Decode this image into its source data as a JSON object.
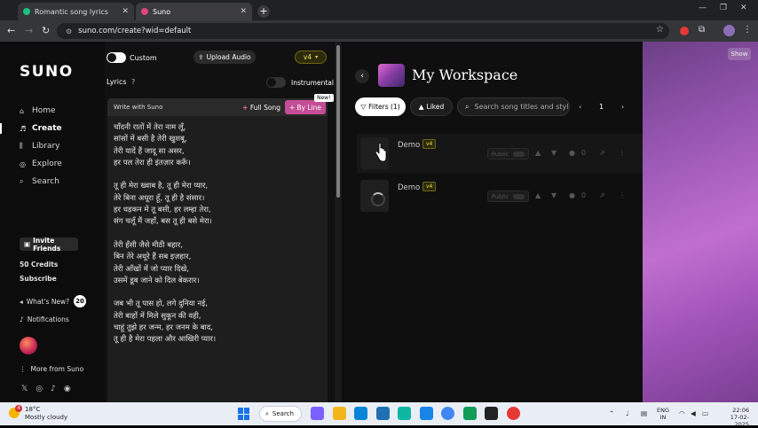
{
  "browser": {
    "tabs": [
      {
        "title": "Romantic song lyrics",
        "favicon_color": "#19c37d"
      },
      {
        "title": "Suno",
        "favicon_color": "#e0457b"
      }
    ],
    "new_tab": "+",
    "url": "suno.com/create?wid=default",
    "controls": {
      "minimize": "—",
      "maximize": "❐",
      "close": "✕"
    },
    "nav": {
      "back": "←",
      "forward": "→",
      "reload": "↻",
      "info": "⚙",
      "star": "☆",
      "extensions": "⧉"
    }
  },
  "sidebar": {
    "logo": "SUNO",
    "nav": [
      {
        "label": "Home",
        "icon": "home-icon",
        "glyph": "⌂"
      },
      {
        "label": "Create",
        "icon": "create-icon",
        "glyph": "♬"
      },
      {
        "label": "Library",
        "icon": "library-icon",
        "glyph": "⫼"
      },
      {
        "label": "Explore",
        "icon": "explore-icon",
        "glyph": "◎"
      },
      {
        "label": "Search",
        "icon": "search-icon",
        "glyph": "⌕"
      }
    ],
    "active": "Create",
    "invite": "Invite Friends",
    "credits": "50 Credits",
    "subscribe": "Subscribe",
    "whats_new": "What's New?",
    "whats_new_count": "20",
    "notifications": "Notifications",
    "more": "More from Suno",
    "socials": [
      "𝕏",
      "◎",
      "♪",
      "◉"
    ]
  },
  "create": {
    "custom_label": "Custom",
    "upload_label": "Upload Audio",
    "version": "v4",
    "lyrics_label": "Lyrics",
    "instrumental_label": "Instrumental",
    "write_with": "Write with Suno",
    "full_song": "Full Song",
    "by_line": "By Line",
    "new_badge": "New!",
    "lyrics_text": "चाँदनी रातों में तेरा नाम लूँ,\nसांसों में बसी है तेरी खुशबू,\nतेरी यादें हैं जादू सा असर,\nहर पल तेरा ही इंतज़ार करूँ।\n\nतू ही मेरा ख्वाब है, तू ही मेरा प्यार,\nतेरे बिना अधूरा हूँ, तू ही है संसार।\nहर धड़कन में तू बसी, हर लम्हा तेरा,\nसंग चलूँ मैं जहाँ, बस तू ही बसे मेरा।\n\nतेरी हँसी जैसे मीठी बहार,\nबिन तेरे अधूरे हैं सब इज़हार,\nतेरी आँखों में जो प्यार दिखे,\nउसमें डूब जाने को दिल बेकरार।\n\nजब भी तू पास हो, लगे दुनिया नई,\nतेरी बाहों में मिले सुकून की वही,\nचाहूं तुझे हर जन्म, हर जनम के बाद,\nतू ही है मेरा पहला और आखिरी प्यार।"
  },
  "workspace": {
    "title": "My Workspace",
    "filters": "Filters (1)",
    "liked": "Liked",
    "search_placeholder": "Search song titles and styles",
    "page": "1",
    "prev": "‹",
    "next": "›",
    "back": "‹",
    "songs": [
      {
        "title": "Demo",
        "version": "v4",
        "public": "Public",
        "likes": "0",
        "state": "ready"
      },
      {
        "title": "Demo",
        "version": "v4",
        "public": "Public",
        "likes": "0",
        "state": "loading"
      }
    ],
    "show_label": "Show"
  },
  "taskbar": {
    "weather_temp": "18°C",
    "weather_desc": "Mostly cloudy",
    "weather_badge": "4",
    "search": "Search",
    "lang_line1": "ENG",
    "lang_line2": "IN",
    "time": "22:06",
    "date": "17-02-2025",
    "app_colors": [
      "#7b61ff",
      "#f2b61c",
      "#0a84d6",
      "#1f6fb2",
      "#0db7a3",
      "#1684e8",
      "#4285f4",
      "#0f9d58",
      "#222222",
      "#e53935"
    ]
  }
}
